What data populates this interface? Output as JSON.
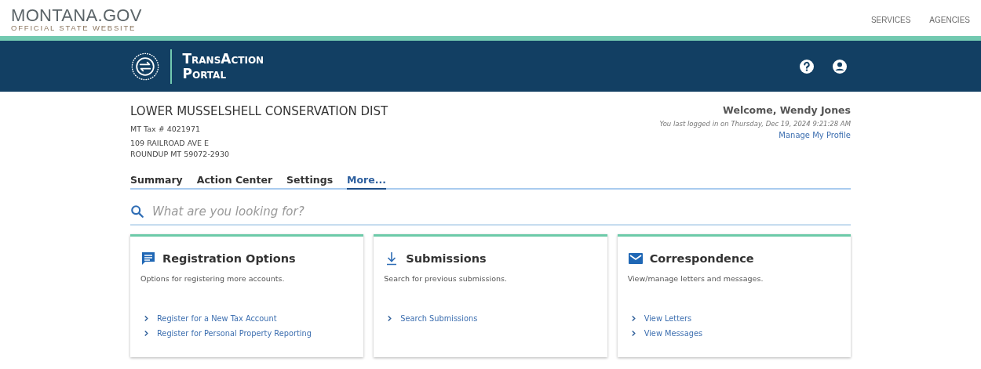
{
  "site_header": {
    "logo_title": "MONTANA.GOV",
    "logo_subtitle": "OFFICIAL STATE WEBSITE",
    "nav": [
      "SERVICES",
      "AGENCIES"
    ]
  },
  "portal_header": {
    "title_lines": [
      "TransAction",
      "Portal"
    ]
  },
  "account": {
    "name": "LOWER MUSSELSHELL CONSERVATION DIST",
    "tax_id": "MT Tax # 4021971",
    "address_lines": [
      "109 RAILROAD AVE E",
      "ROUNDUP MT 59072-2930"
    ]
  },
  "user": {
    "welcome": "Welcome, Wendy Jones",
    "last_login": "You last logged in on Thursday, Dec 19, 2024 9:21:28 AM",
    "profile_link": "Manage My Profile"
  },
  "tabs": [
    {
      "label": "Summary",
      "selected": false
    },
    {
      "label": "Action Center",
      "selected": false
    },
    {
      "label": "Settings",
      "selected": false
    },
    {
      "label": "More...",
      "selected": true
    }
  ],
  "search": {
    "placeholder": "What are you looking for?"
  },
  "cards": [
    {
      "kind": "chat",
      "title": "Registration Options",
      "description": "Options for registering more accounts.",
      "links": [
        "Register for a New Tax Account",
        "Register for Personal Property Reporting"
      ]
    },
    {
      "kind": "download",
      "title": "Submissions",
      "description": "Search for previous submissions.",
      "links": [
        "Search Submissions"
      ]
    },
    {
      "kind": "mail",
      "title": "Correspondence",
      "description": "View/manage letters and messages.",
      "links": [
        "View Letters",
        "View Messages"
      ]
    }
  ]
}
